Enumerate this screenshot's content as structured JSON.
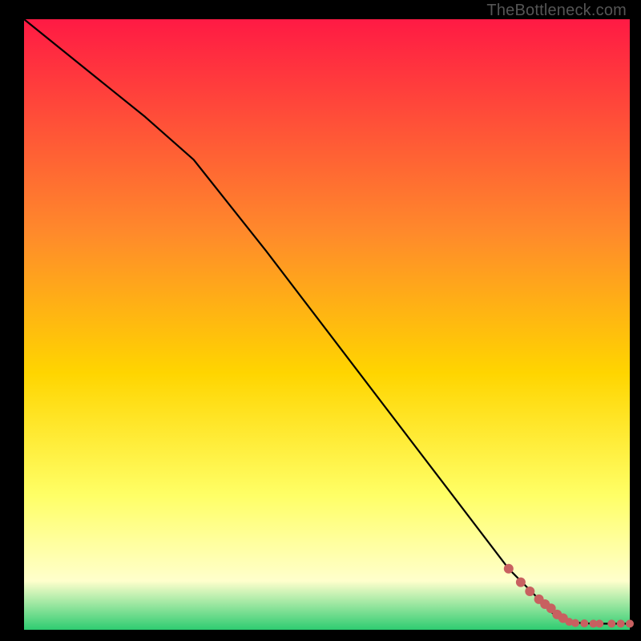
{
  "attribution": "TheBottleneck.com",
  "chart_data": {
    "type": "line",
    "title": "",
    "xlabel": "",
    "ylabel": "",
    "xlim": [
      0,
      100
    ],
    "ylim": [
      0,
      100
    ],
    "colors": {
      "gradient_top": "#ff1a44",
      "gradient_mid_upper": "#ff8a2b",
      "gradient_mid": "#ffd500",
      "gradient_lower": "#ffff66",
      "gradient_pale": "#ffffcc",
      "gradient_bottom": "#2ecc71",
      "curve": "#000000",
      "markers": "#c86060"
    },
    "series": [
      {
        "name": "bottleneck-curve",
        "x": [
          0,
          10,
          20,
          28,
          40,
          50,
          60,
          70,
          80,
          85,
          88,
          90,
          92,
          94,
          96,
          98,
          100
        ],
        "y": [
          100,
          92,
          84,
          77,
          62,
          49,
          36,
          23,
          10,
          5,
          2,
          1.3,
          1.1,
          1.0,
          1.0,
          1.0,
          1.0
        ]
      }
    ],
    "markers": {
      "name": "highlighted-points",
      "x": [
        80,
        82,
        83.5,
        85,
        86,
        87,
        88,
        89,
        90,
        91,
        92.5,
        94,
        95,
        97,
        98.5,
        100
      ],
      "y": [
        10,
        7.8,
        6.3,
        5,
        4.2,
        3.5,
        2.5,
        1.9,
        1.3,
        1.1,
        1.05,
        1.0,
        1.0,
        1.0,
        1.0,
        1.0
      ]
    }
  }
}
